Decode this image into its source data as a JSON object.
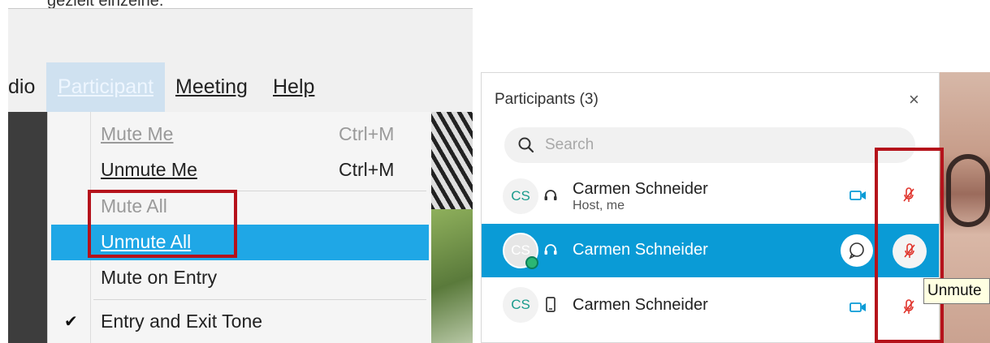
{
  "caption": "gezielt einzelne.",
  "menubar": {
    "items": [
      {
        "id": "audio",
        "label": "dio"
      },
      {
        "id": "participant",
        "label": "Participant"
      },
      {
        "id": "meeting",
        "label": "Meeting"
      },
      {
        "id": "help",
        "label": "Help"
      }
    ]
  },
  "dropdown": {
    "items": [
      {
        "label": "Mute Me",
        "shortcut": "Ctrl+M",
        "state": "disabled"
      },
      {
        "label": "Unmute Me",
        "shortcut": "Ctrl+M",
        "state": "normal"
      },
      {
        "label": "Mute All",
        "shortcut": "",
        "state": "disabled"
      },
      {
        "label": "Unmute All",
        "shortcut": "",
        "state": "highlighted"
      },
      {
        "label": "Mute on Entry",
        "shortcut": "",
        "state": "normal"
      },
      {
        "label": "Entry and Exit Tone",
        "shortcut": "",
        "state": "checked"
      }
    ],
    "check_glyph": "✔"
  },
  "participants_panel": {
    "title": "Participants (3)",
    "close_glyph": "×",
    "search_placeholder": "Search",
    "rows": [
      {
        "initials": "CS",
        "name": "Carmen Schneider",
        "subtitle": "Host, me",
        "audio": "headset-icon",
        "video": true,
        "muted": true,
        "selected": false
      },
      {
        "initials": "CS",
        "name": "Carmen Schneider",
        "subtitle": "",
        "audio": "headset-icon",
        "video": false,
        "muted": true,
        "selected": true
      },
      {
        "initials": "CS",
        "name": "Carmen Schneider",
        "subtitle": "",
        "audio": "phone-icon",
        "video": true,
        "muted": true,
        "selected": false
      }
    ]
  },
  "tooltip": "Unmute",
  "colors": {
    "highlight": "#1fa7e6",
    "selected_row": "#0a9bd6",
    "annotation_red": "#b5121b",
    "muted_red": "#e0332b",
    "avatar_text": "#1a9b8c"
  }
}
